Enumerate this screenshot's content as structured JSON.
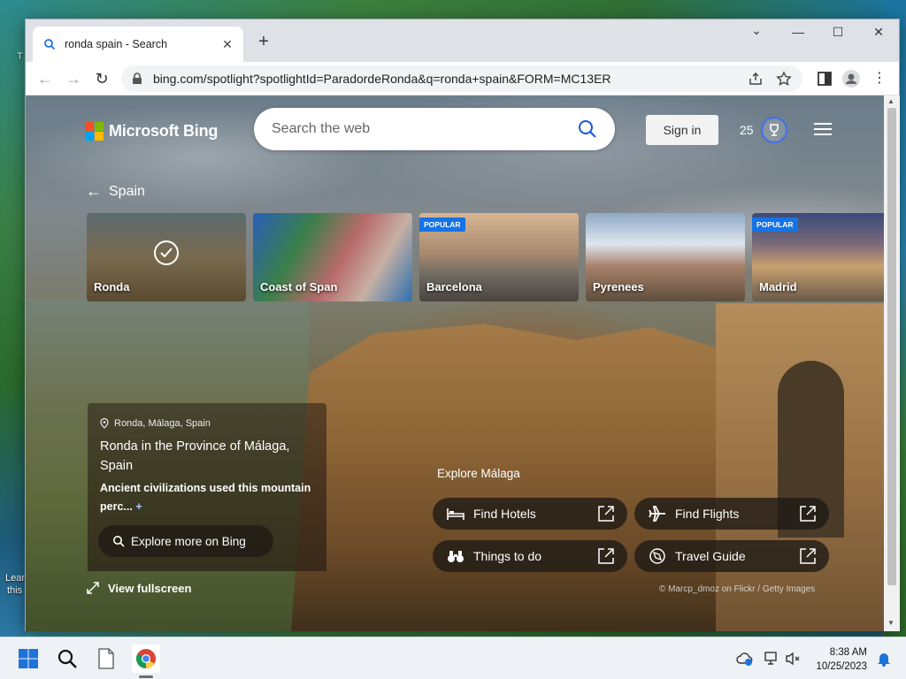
{
  "desktop": {
    "labels": [
      "T",
      "Lear",
      "this"
    ]
  },
  "browser": {
    "tab": {
      "title": "ronda spain - Search",
      "close": "✕"
    },
    "new_tab": "+",
    "url": "bing.com/spotlight?spotlightId=ParadordeRonda&q=ronda+spain&FORM=MC13ER"
  },
  "bing": {
    "logo_text": "Microsoft Bing",
    "search_placeholder": "Search the web",
    "sign_in": "Sign in",
    "rewards_points": "25",
    "back_label": "Spain",
    "cards": [
      {
        "label": "Ronda",
        "badge": "",
        "selected": true
      },
      {
        "label": "Coast of Span",
        "badge": "",
        "selected": false
      },
      {
        "label": "Barcelona",
        "badge": "POPULAR",
        "selected": false
      },
      {
        "label": "Pyrenees",
        "badge": "",
        "selected": false
      },
      {
        "label": "Madrid",
        "badge": "POPULAR",
        "selected": false
      }
    ],
    "info": {
      "location": "Ronda, Málaga, Spain",
      "title": "Ronda in the Province of Málaga, Spain",
      "description": "Ancient civilizations used this mountain perc...",
      "more": "+"
    },
    "explore_button": "Explore more on Bing",
    "fullscreen": "View fullscreen",
    "explore_heading": "Explore Málaga",
    "actions": [
      {
        "label": "Find Hotels",
        "icon": "bed-icon"
      },
      {
        "label": "Find Flights",
        "icon": "airplane-icon"
      },
      {
        "label": "Things to do",
        "icon": "binoculars-icon"
      },
      {
        "label": "Travel Guide",
        "icon": "compass-icon"
      }
    ],
    "credit": "© Marcp_dmoz on Flickr / Getty Images"
  },
  "taskbar": {
    "time": "8:38 AM",
    "date": "10/25/2023"
  },
  "colors": {
    "accent_blue": "#1473e6",
    "rewards_ring": "#3f6ff0",
    "logo": [
      "#f25022",
      "#7fba00",
      "#00a4ef",
      "#ffb900"
    ]
  }
}
